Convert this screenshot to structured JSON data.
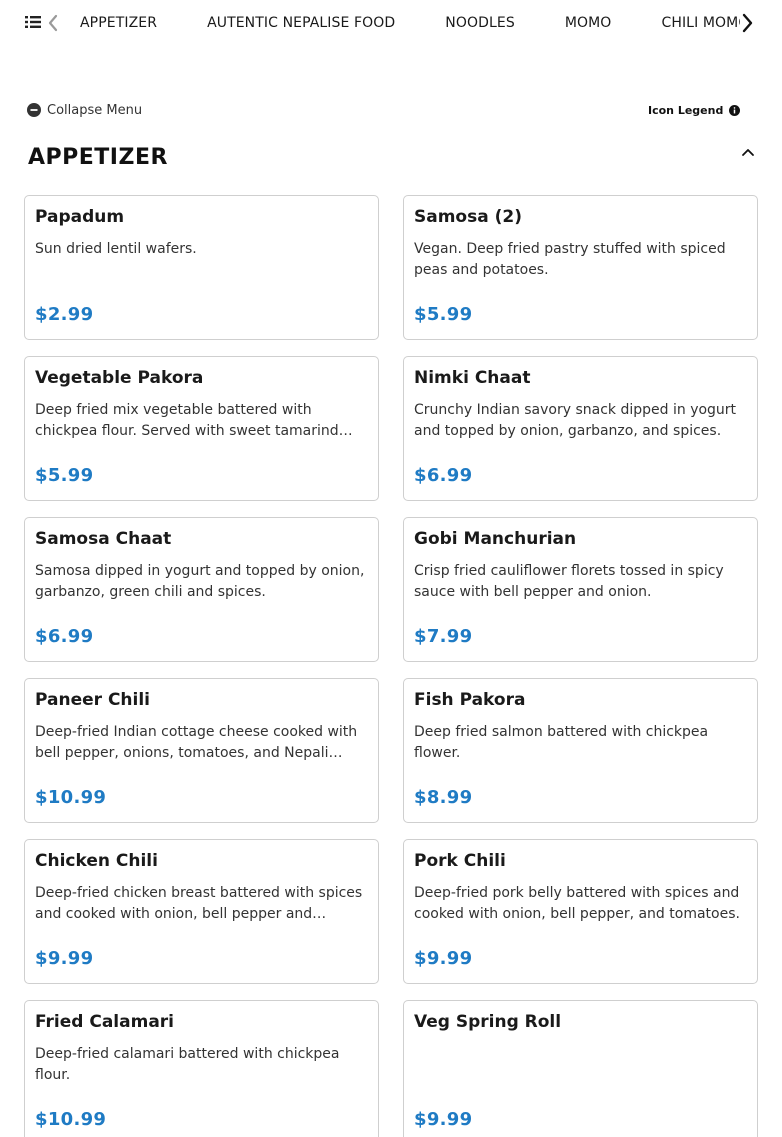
{
  "categories": [
    "APPETIZER",
    "AUTENTIC NEPALISE FOOD",
    "NOODLES",
    "MOMO",
    "CHILI MOMO"
  ],
  "menu_controls": {
    "collapse_label": "Collapse Menu",
    "legend_label": "Icon Legend"
  },
  "section": {
    "title": "APPETIZER"
  },
  "items": [
    {
      "name": "Papadum",
      "description": "Sun dried lentil wafers.",
      "price": "$2.99"
    },
    {
      "name": "Samosa (2)",
      "description": "Vegan. Deep fried pastry stuffed with spiced peas and potatoes.",
      "price": "$5.99"
    },
    {
      "name": "Vegetable Pakora",
      "description": "Deep fried mix vegetable battered with chickpea flour. Served with sweet tamarind…",
      "price": "$5.99"
    },
    {
      "name": "Nimki Chaat",
      "description": "Crunchy Indian savory snack dipped in yogurt and topped by onion, garbanzo, and spices.",
      "price": "$6.99"
    },
    {
      "name": "Samosa Chaat",
      "description": "Samosa dipped in yogurt and topped by onion, garbanzo, green chili and spices.",
      "price": "$6.99"
    },
    {
      "name": "Gobi Manchurian",
      "description": "Crisp fried cauliflower florets tossed in spicy sauce with bell pepper and onion.",
      "price": "$7.99"
    },
    {
      "name": "Paneer Chili",
      "description": "Deep-fried Indian cottage cheese cooked with bell pepper, onions, tomatoes, and Nepali…",
      "price": "$10.99"
    },
    {
      "name": "Fish Pakora",
      "description": "Deep fried salmon battered with chickpea flower.",
      "price": "$8.99"
    },
    {
      "name": "Chicken Chili",
      "description": "Deep-fried chicken breast battered with spices and cooked with onion, bell pepper and…",
      "price": "$9.99"
    },
    {
      "name": "Pork Chili",
      "description": "Deep-fried pork belly battered with spices and cooked with onion, bell pepper, and tomatoes.",
      "price": "$9.99"
    },
    {
      "name": "Fried Calamari",
      "description": "Deep-fried calamari battered with chickpea flour.",
      "price": "$10.99"
    },
    {
      "name": "Veg Spring Roll",
      "description": "",
      "price": "$9.99"
    }
  ],
  "icons": {
    "category_list": "list-icon",
    "prev": "chevron-left-icon",
    "next": "chevron-right-icon",
    "collapse": "minus-circle-icon",
    "legend": "info-icon",
    "section_toggle": "chevron-up-icon"
  },
  "colors": {
    "price": "#1f7bc4",
    "card_border": "#cfcfcf"
  }
}
